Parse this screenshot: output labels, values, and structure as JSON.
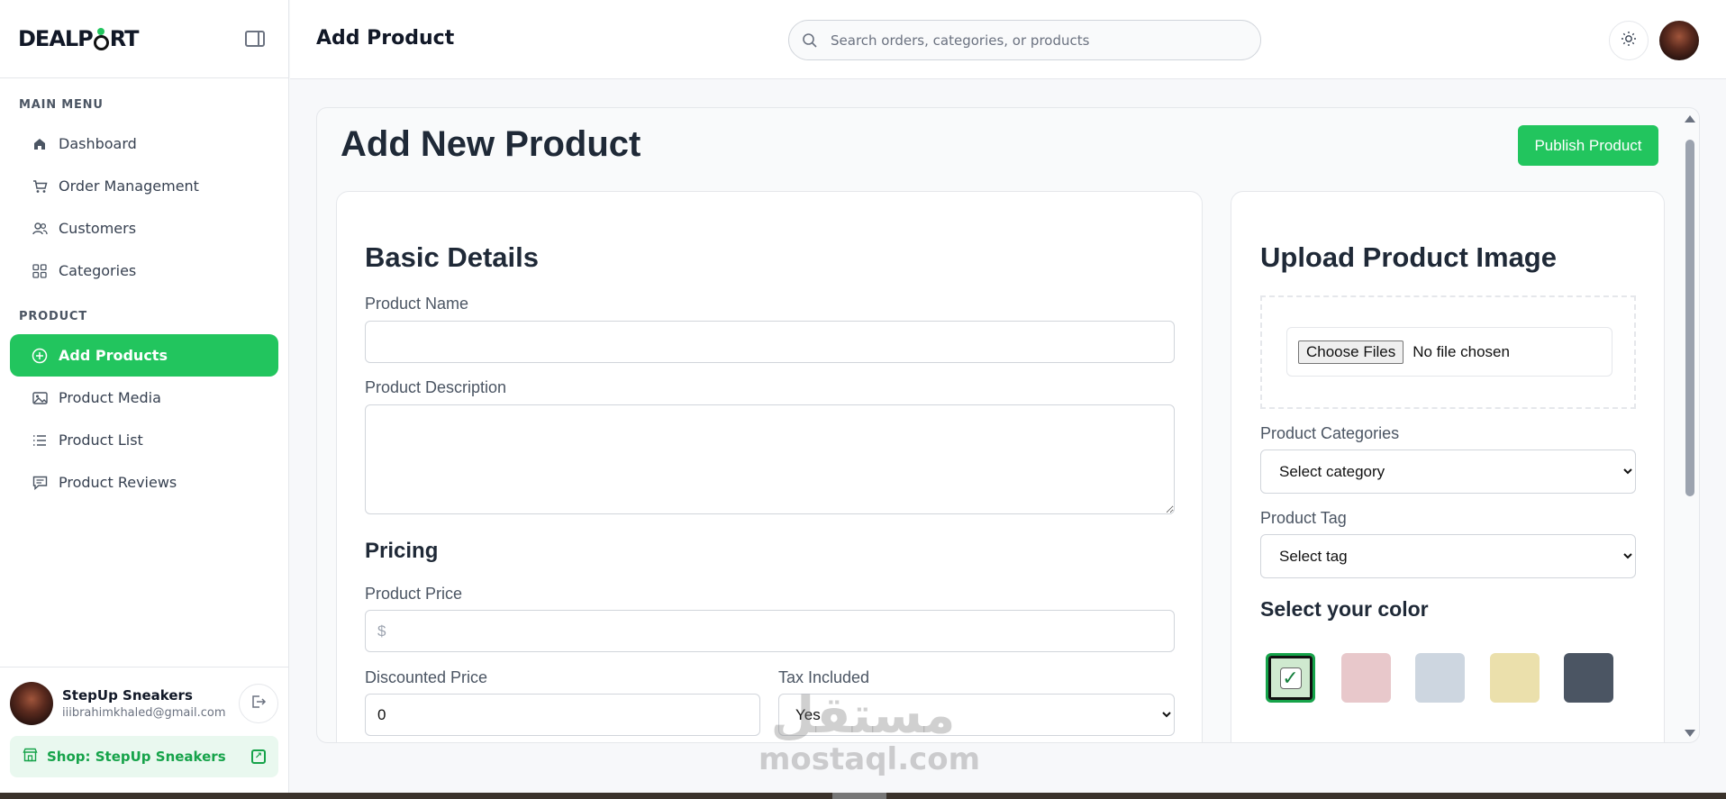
{
  "sidebar": {
    "logo": {
      "part1": "DEALP",
      "part2": "RT"
    },
    "main_menu_label": "MAIN MENU",
    "main_items": [
      {
        "label": "Dashboard",
        "icon": "home-icon"
      },
      {
        "label": "Order Management",
        "icon": "cart-icon"
      },
      {
        "label": "Customers",
        "icon": "users-icon"
      },
      {
        "label": "Categories",
        "icon": "grid-icon"
      }
    ],
    "product_label": "PRODUCT",
    "product_items": [
      {
        "label": "Add Products",
        "icon": "plus-circle-icon",
        "active": true
      },
      {
        "label": "Product Media",
        "icon": "image-icon"
      },
      {
        "label": "Product List",
        "icon": "list-icon"
      },
      {
        "label": "Product Reviews",
        "icon": "message-icon"
      }
    ],
    "user": {
      "name": "StepUp Sneakers",
      "email": "iiibrahimkhaled@gmail.com"
    },
    "shop_label": "Shop: StepUp Sneakers"
  },
  "header": {
    "title": "Add Product",
    "search_placeholder": "Search orders, categories, or products"
  },
  "main": {
    "title": "Add New Product",
    "publish_label": "Publish Product",
    "basic_details": {
      "heading": "Basic Details",
      "name_label": "Product Name",
      "name_value": "",
      "description_label": "Product Description",
      "description_value": ""
    },
    "pricing": {
      "heading": "Pricing",
      "price_label": "Product Price",
      "price_placeholder": "$",
      "discount_label": "Discounted Price",
      "discount_value": "0",
      "tax_label": "Tax Included",
      "tax_value": "Yes"
    },
    "upload": {
      "heading": "Upload Product Image",
      "file_button": "Choose Files",
      "file_status": "No file chosen"
    },
    "categories": {
      "label": "Product Categories",
      "value": "Select category"
    },
    "tag": {
      "label": "Product Tag",
      "value": "Select tag"
    },
    "colors": {
      "heading": "Select your color",
      "swatches": [
        "#cfe9cf",
        "#e8c8cb",
        "#cdd6e0",
        "#ebe0ac",
        "#4b5563"
      ],
      "selected_index": 0,
      "check_mark": "✓"
    }
  },
  "watermark": {
    "arabic": "مستقل",
    "latin": "mostaql.com"
  }
}
